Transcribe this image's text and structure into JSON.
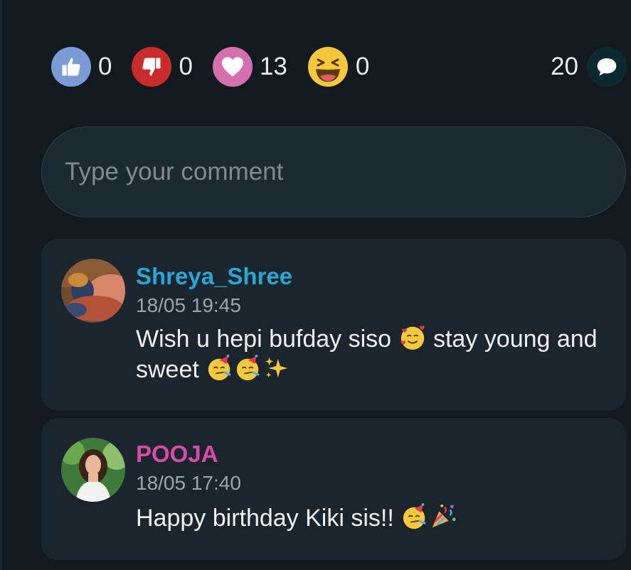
{
  "reactions": [
    {
      "type": "like",
      "icon": "thumbs-up-icon",
      "color": "#7a9bd6",
      "count": "0"
    },
    {
      "type": "dislike",
      "icon": "thumbs-down-icon",
      "color": "#c92b2b",
      "count": "0"
    },
    {
      "type": "love",
      "icon": "heart-icon",
      "color": "#d56fae",
      "count": "13"
    },
    {
      "type": "haha",
      "icon": "laughing-face-icon",
      "color": "#f6c93b",
      "count": "0"
    }
  ],
  "comments_count": {
    "count": "20",
    "icon": "comment-bubble-icon"
  },
  "comment_input": {
    "placeholder": "Type your comment",
    "value": ""
  },
  "comments": [
    {
      "author": "Shreya_Shree",
      "author_color": "#26a8d6",
      "time": "18/05 19:45",
      "text_part1": "Wish u hepi bufday siso ",
      "text_part2": " stay young and sweet ",
      "emojis": [
        "smiling-face-with-hearts-emoji",
        "partying-face-emoji",
        "partying-face-emoji",
        "sparkles-emoji"
      ]
    },
    {
      "author": "POOJA",
      "author_color": "#d84ba6",
      "time": "18/05 17:40",
      "text_part1": "Happy birthday Kiki sis!! ",
      "emojis": [
        "partying-face-emoji",
        "party-popper-emoji"
      ]
    }
  ]
}
